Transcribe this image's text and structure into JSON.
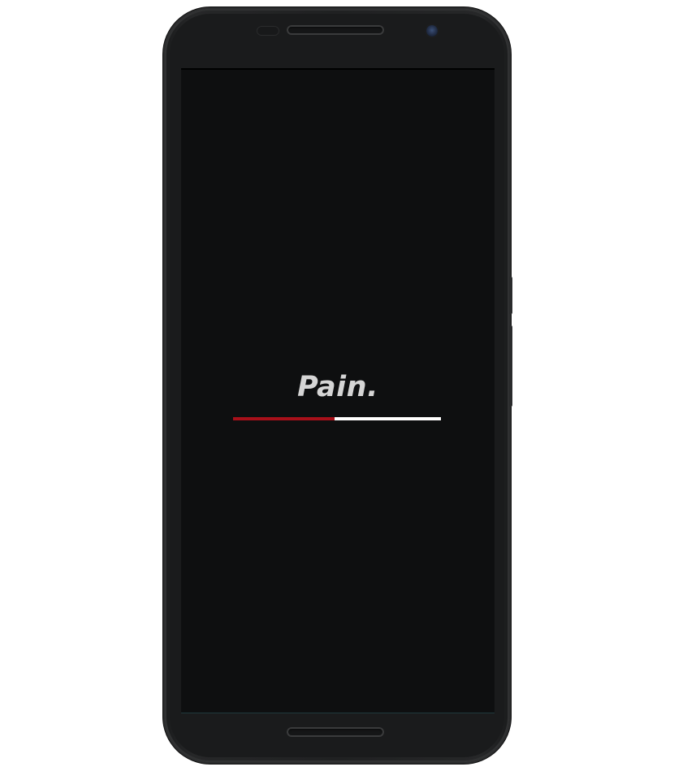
{
  "app": {
    "brand_text": "Pain."
  },
  "loading": {
    "progress_fraction": 0.49
  },
  "colors": {
    "background": "#0e0f10",
    "brand_text": "#d5d5d5",
    "progress_fill": "#a8101a",
    "progress_track": "#ffffff"
  }
}
